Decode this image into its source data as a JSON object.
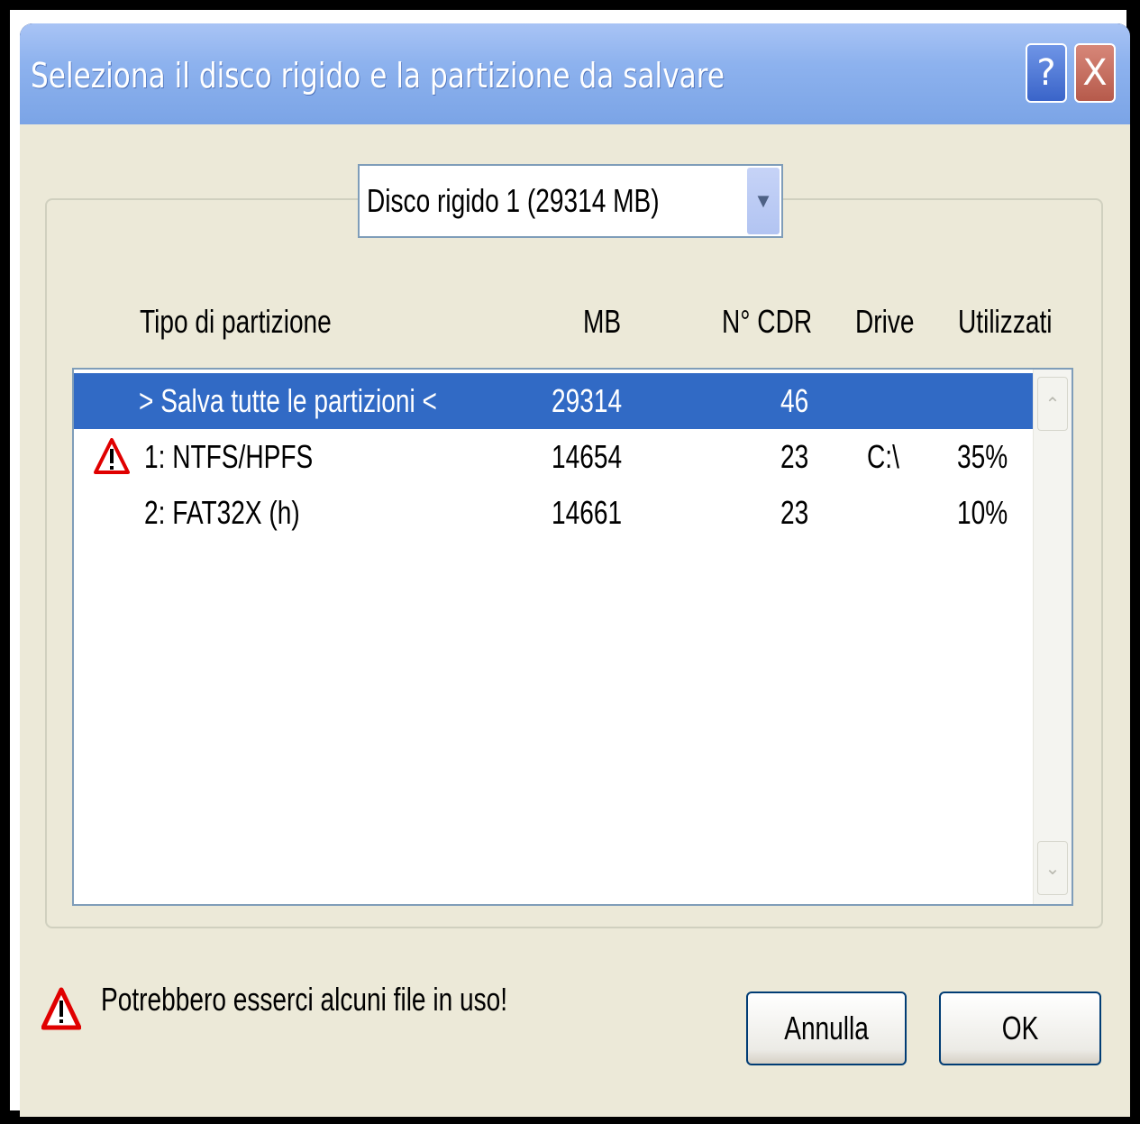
{
  "window": {
    "title": "Seleziona il disco rigido e la partizione da salvare",
    "help_label": "?",
    "close_label": "X"
  },
  "disk_select": {
    "value": "Disco rigido 1 (29314 MB)"
  },
  "columns": {
    "type": "Tipo di partizione",
    "mb": "MB",
    "cdr": "N° CDR",
    "drive": "Drive",
    "used": "Utilizzati"
  },
  "rows": [
    {
      "type": "> Salva tutte le partizioni <",
      "mb": "29314",
      "cdr": "46",
      "drive": "",
      "used": ""
    },
    {
      "type": "1: NTFS/HPFS",
      "mb": "14654",
      "cdr": "23",
      "drive": "C:\\",
      "used": "35%"
    },
    {
      "type": "2: FAT32X (h)",
      "mb": "14661",
      "cdr": "23",
      "drive": "",
      "used": "10%"
    }
  ],
  "footer": {
    "warning": "Potrebbero esserci alcuni file in uso!"
  },
  "buttons": {
    "cancel": "Annulla",
    "ok": "OK"
  },
  "colors": {
    "selection": "#316ac5",
    "warning": "#e00000"
  }
}
